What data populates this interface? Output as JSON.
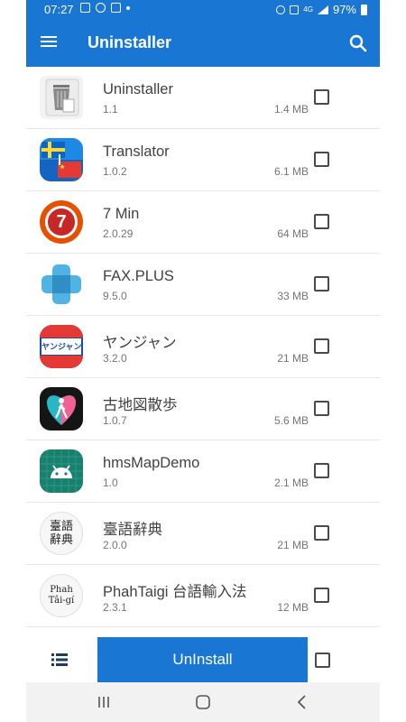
{
  "status_bar": {
    "time": "07:27",
    "battery": "97%",
    "network": "4G"
  },
  "app_bar": {
    "title": "Uninstaller"
  },
  "apps": [
    {
      "name": "Uninstaller",
      "version": "1.1",
      "size": "1.4 MB",
      "icon": "trash-can-icon"
    },
    {
      "name": "Translator",
      "version": "1.0.2",
      "size": "6.1 MB",
      "icon": "flags-icon"
    },
    {
      "name": "7 Min",
      "version": "2.0.29",
      "size": "64 MB",
      "icon": "seven-circle-icon"
    },
    {
      "name": "FAX.PLUS",
      "version": "9.5.0",
      "size": "33 MB",
      "icon": "fax-plus-icon"
    },
    {
      "name": "ヤンジャン",
      "version": "3.2.0",
      "size": "21 MB",
      "icon": "yanjan-icon"
    },
    {
      "name": "古地図散歩",
      "version": "1.0.7",
      "size": "5.6 MB",
      "icon": "map-walker-icon"
    },
    {
      "name": "hmsMapDemo",
      "version": "1.0",
      "size": "2.1 MB",
      "icon": "android-icon"
    },
    {
      "name": "臺語辭典",
      "version": "2.0.0",
      "size": "21 MB",
      "icon": "dictionary-icon"
    },
    {
      "name": "PhahTaigi 台語輸入法",
      "version": "2.3.1",
      "size": "12 MB",
      "icon": "phahtaigi-icon"
    }
  ],
  "icon_text": {
    "seven": "7",
    "yanjan": "ヤンジャン!",
    "dict_line1": "臺語",
    "dict_line2": "辭典",
    "phah_line1": "Phah",
    "phah_line2": "Tâi-gí"
  },
  "bottom_bar": {
    "uninstall_label": "UnInstall"
  },
  "colors": {
    "primary": "#1976d2",
    "text": "#424242",
    "secondary_text": "#757575"
  }
}
